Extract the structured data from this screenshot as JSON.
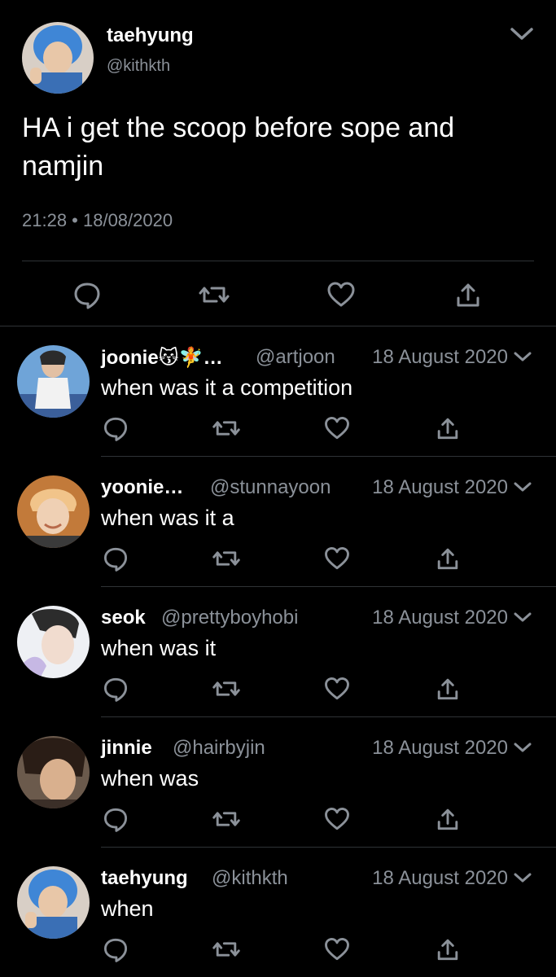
{
  "main_tweet": {
    "name": "taehyung",
    "handle": "@kithkth",
    "text": "HA i get the scoop before sope and namjin",
    "timestamp": "21:28 • 18/08/2020",
    "icons": [
      "reply-icon",
      "retweet-icon",
      "like-icon",
      "share-icon",
      "chevron-down-icon"
    ]
  },
  "replies": [
    {
      "name": "joonie😽🧚…",
      "handle": "@artjoon",
      "date": "18 August 2020",
      "text": "when was it a competition"
    },
    {
      "name": "yoonie…",
      "handle": "@stunnayoon",
      "date": "18 August 2020",
      "text": "when was it a"
    },
    {
      "name": "seok",
      "handle": "@prettyboyhobi",
      "date": "18 August 2020",
      "text": "when was it"
    },
    {
      "name": "jinnie",
      "handle": "@hairbyjin",
      "date": "18 August 2020",
      "text": "when was"
    },
    {
      "name": "taehyung",
      "handle": "@kithkth",
      "date": "18 August 2020",
      "text": "when"
    }
  ],
  "colors": {
    "background": "#000000",
    "text": "#ffffff",
    "secondary": "#8b9199",
    "divider": "#2f3336"
  }
}
